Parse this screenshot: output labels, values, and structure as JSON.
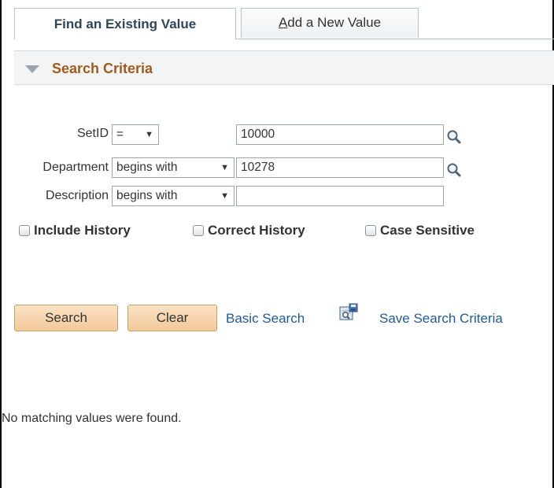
{
  "tabs": {
    "active_label": "Find an Existing Value",
    "inactive_label_first": "A",
    "inactive_label_rest": "dd a New Value"
  },
  "section": {
    "title": "Search Criteria"
  },
  "fields": {
    "setid": {
      "label": "SetID",
      "operator": "=",
      "value": "10000"
    },
    "department": {
      "label": "Department",
      "operator": "begins with",
      "value": "10278"
    },
    "description": {
      "label": "Description",
      "operator": "begins with",
      "value": ""
    }
  },
  "checkboxes": {
    "include_history": "Include History",
    "correct_history": "Correct History",
    "case_sensitive": "Case Sensitive"
  },
  "buttons": {
    "search": "Search",
    "clear": "Clear"
  },
  "links": {
    "basic_search": "Basic Search",
    "save_search": "Save Search Criteria"
  },
  "message": "No matching values were found.",
  "icons": {
    "lookup": "magnifier-icon",
    "save_search": "save-search-icon",
    "section_toggle": "collapse-triangle-icon"
  },
  "colors": {
    "section_title": "#a15b1c",
    "link": "#1f5a99",
    "button_bg": "#f3c89a"
  }
}
